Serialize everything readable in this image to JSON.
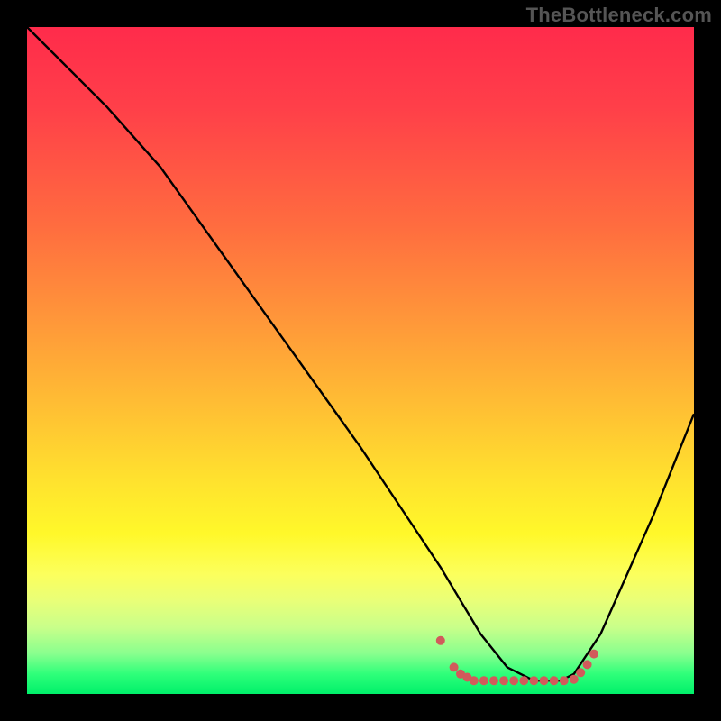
{
  "watermark": "TheBottleneck.com",
  "chart_data": {
    "type": "line",
    "title": "",
    "xlabel": "",
    "ylabel": "",
    "xlim": [
      0,
      100
    ],
    "ylim": [
      0,
      100
    ],
    "grid": false,
    "legend": false,
    "series": [
      {
        "name": "curve",
        "color": "#000000",
        "x": [
          0,
          6,
          12,
          20,
          30,
          40,
          50,
          58,
          62,
          65,
          68,
          72,
          76,
          80,
          82,
          86,
          90,
          94,
          100
        ],
        "y": [
          100,
          94,
          88,
          79,
          65,
          51,
          37,
          25,
          19,
          14,
          9,
          4,
          2,
          2,
          3,
          9,
          18,
          27,
          42
        ]
      },
      {
        "name": "bottom-marks-left",
        "color": "#d15b5b",
        "x": [
          62,
          64,
          65,
          66
        ],
        "y": [
          8,
          4,
          3,
          2.5
        ]
      },
      {
        "name": "bottom-marks-flat",
        "color": "#d15b5b",
        "x": [
          67,
          68.5,
          70,
          71.5,
          73,
          74.5,
          76,
          77.5,
          79,
          80.5,
          82
        ],
        "y": [
          2,
          2,
          2,
          2,
          2,
          2,
          2,
          2,
          2,
          2,
          2.2
        ]
      },
      {
        "name": "bottom-marks-right",
        "color": "#d15b5b",
        "x": [
          83,
          84,
          85
        ],
        "y": [
          3.2,
          4.4,
          6
        ]
      }
    ]
  }
}
